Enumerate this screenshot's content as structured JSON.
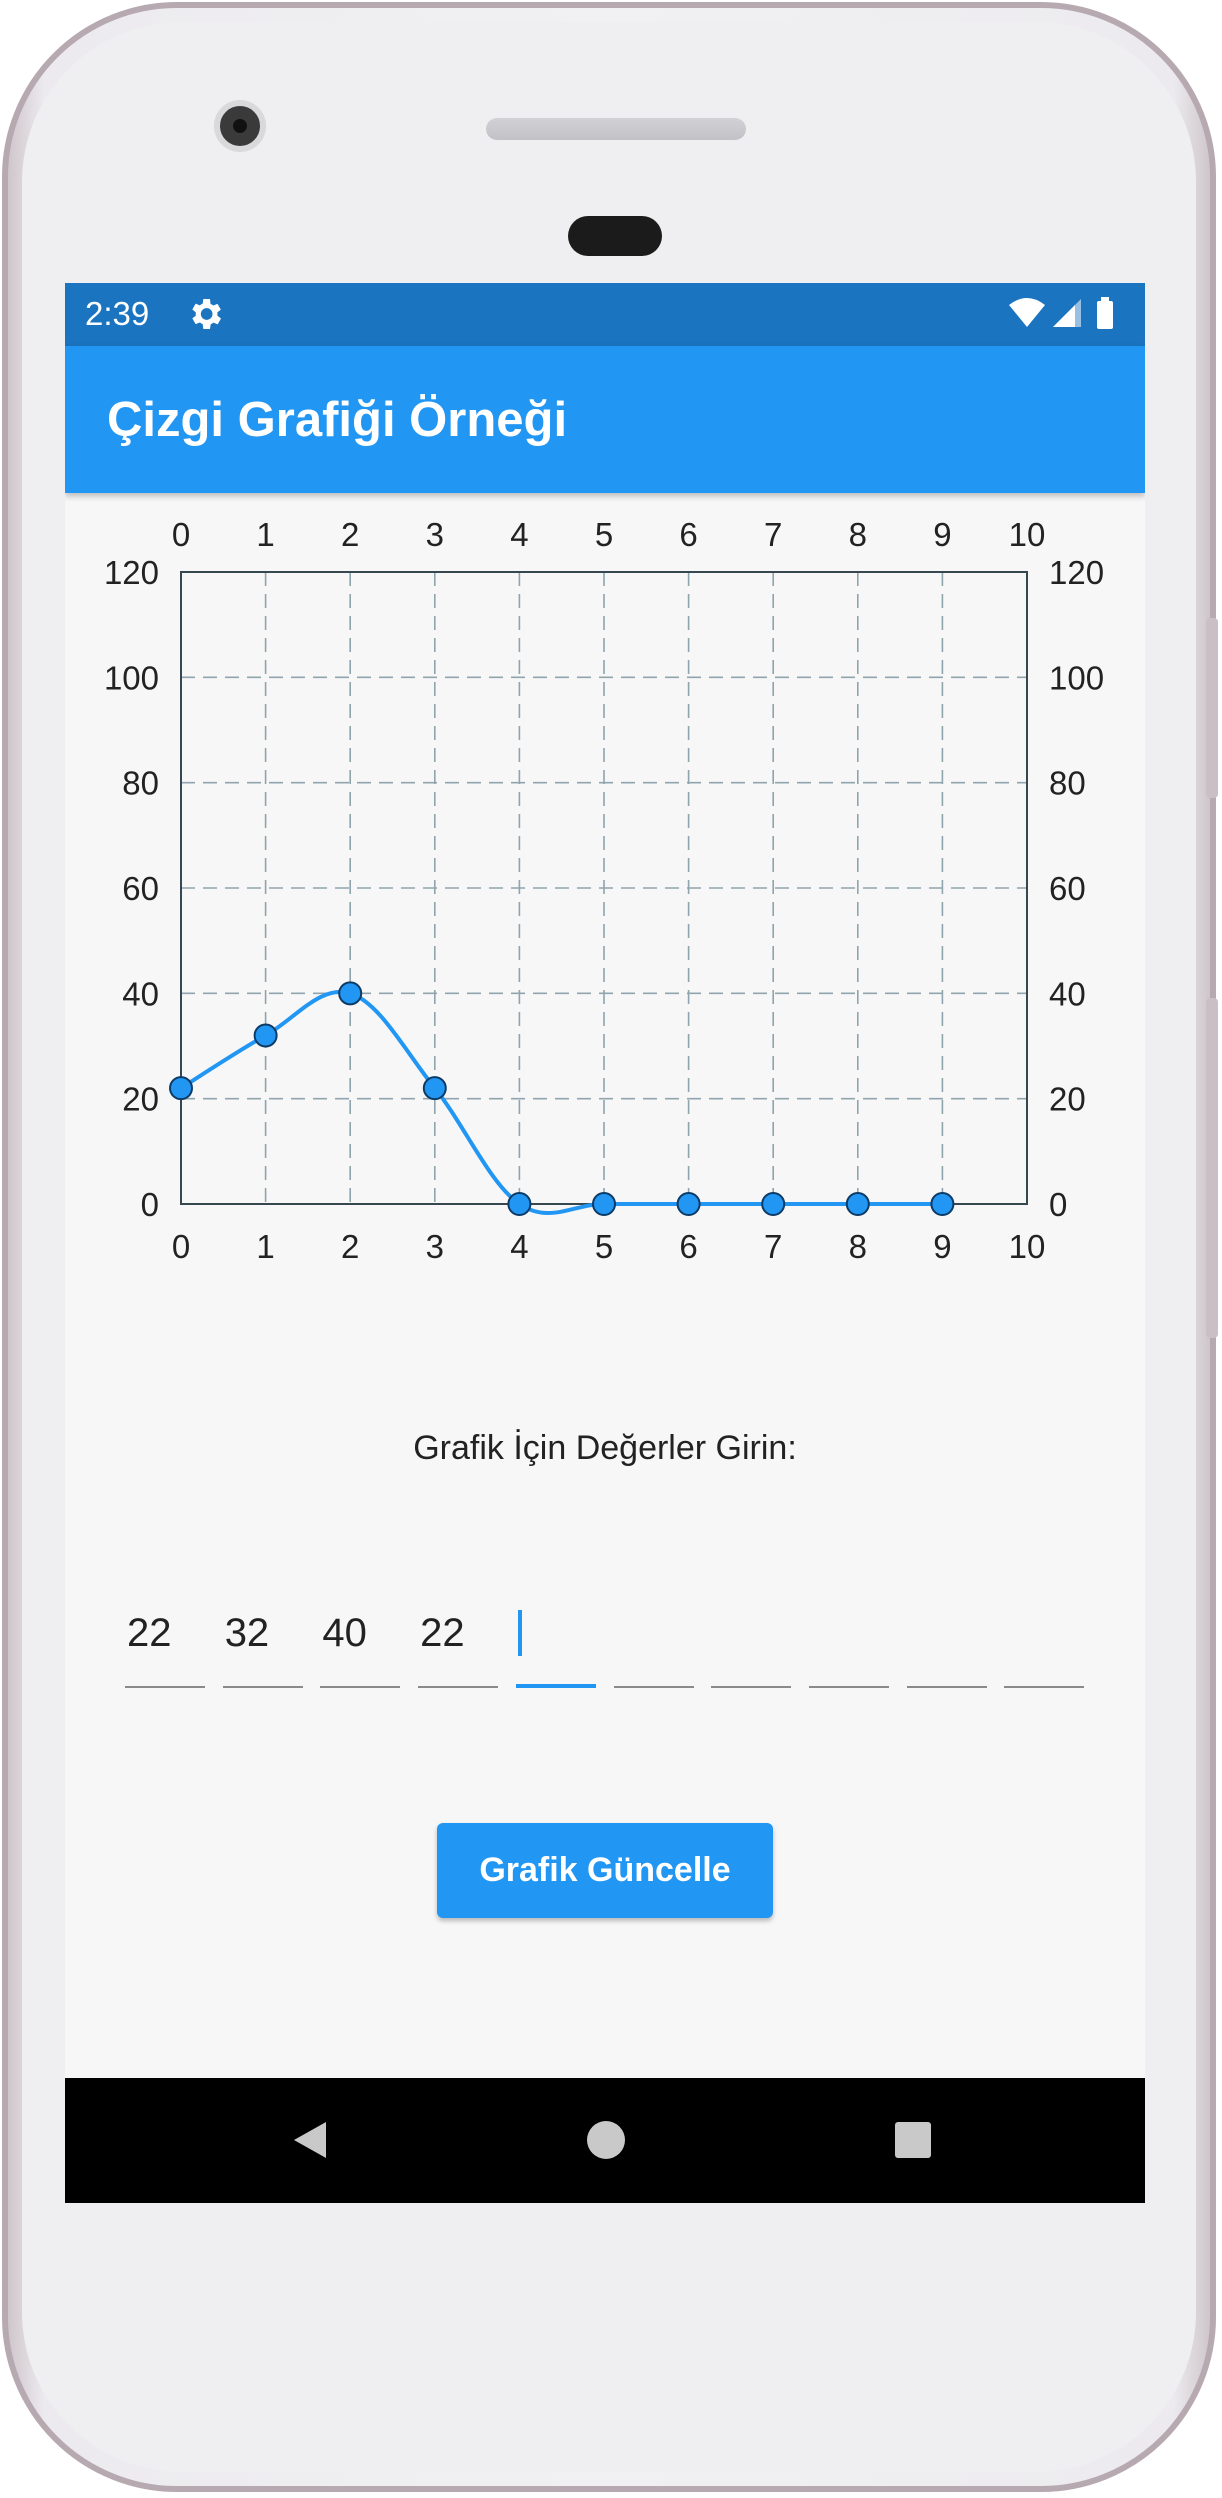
{
  "status_bar": {
    "time": "2:39",
    "icons": [
      "gear-icon",
      "wifi-icon",
      "signal-icon",
      "battery-icon"
    ]
  },
  "app_bar": {
    "title": "Çizgi Grafiği Örneği",
    "color": "#2296f3",
    "status_color": "#1b74c0"
  },
  "chart_data": {
    "type": "line",
    "x": [
      0,
      1,
      2,
      3,
      4,
      5,
      6,
      7,
      8,
      9
    ],
    "series": [
      {
        "values": [
          22,
          32,
          40,
          22,
          0,
          0,
          0,
          0,
          0,
          0
        ]
      }
    ],
    "xlim": [
      0,
      10
    ],
    "ylim": [
      0,
      120
    ],
    "x_ticks": [
      "0",
      "1",
      "2",
      "3",
      "4",
      "5",
      "6",
      "7",
      "8",
      "9",
      "10"
    ],
    "y_ticks": [
      "0",
      "20",
      "40",
      "60",
      "80",
      "100",
      "120"
    ],
    "grid": true,
    "line_color": "#2296f3",
    "smooth": true,
    "title": "",
    "xlabel": "",
    "ylabel": ""
  },
  "input_section": {
    "prompt": "Grafik İçin Değerler Girin:",
    "values": [
      "22",
      "32",
      "40",
      "22",
      "",
      "",
      "",
      "",
      "",
      ""
    ],
    "active_index": 4
  },
  "update_button": {
    "label": "Grafik Güncelle"
  },
  "nav_bar": {
    "icons": [
      "back-icon",
      "home-icon",
      "recent-apps-icon"
    ]
  }
}
